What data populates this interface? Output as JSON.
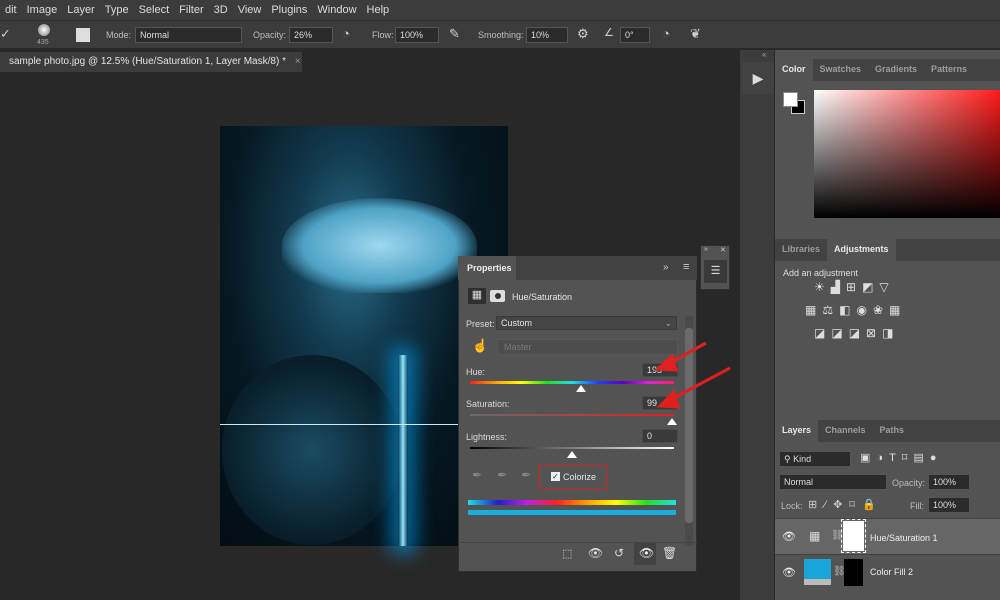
{
  "menu": [
    "dit",
    "Image",
    "Layer",
    "Type",
    "Select",
    "Filter",
    "3D",
    "View",
    "Plugins",
    "Window",
    "Help"
  ],
  "options": {
    "brush_size": "435",
    "mode_label": "Mode:",
    "mode_value": "Normal",
    "opacity_label": "Opacity:",
    "opacity_value": "26%",
    "flow_label": "Flow:",
    "flow_value": "100%",
    "smoothing_label": "Smoothing:",
    "smoothing_value": "10%",
    "angle_value": "0°"
  },
  "document_tab": {
    "title": "sample photo.jpg @ 12.5% (Hue/Saturation 1, Layer Mask/8) *",
    "close": "×"
  },
  "color_panel": {
    "tabs": [
      "Color",
      "Swatches",
      "Gradients",
      "Patterns"
    ],
    "active": "Color",
    "foreground": "#ffffff",
    "background": "#000000",
    "hue_color": "#ff1a1a"
  },
  "adjustments_panel": {
    "tabs": [
      "Libraries",
      "Adjustments"
    ],
    "active": "Adjustments",
    "hint": "Add an adjustment"
  },
  "properties": {
    "title": "Properties",
    "type": "Hue/Saturation",
    "preset_label": "Preset:",
    "preset_value": "Custom",
    "channel_value": "Master",
    "hue_label": "Hue:",
    "hue_value": "195",
    "saturation_label": "Saturation:",
    "saturation_value": "99",
    "lightness_label": "Lightness:",
    "lightness_value": "0",
    "colorize_label": "Colorize",
    "colorize_checked": true,
    "hue": 195,
    "saturation": 99,
    "lightness": 0,
    "colorize_color": "#1aaee0",
    "annotation_color": "#e02020"
  },
  "layers_panel": {
    "tabs": [
      "Layers",
      "Channels",
      "Paths"
    ],
    "active": "Layers",
    "filter_kind": "Kind",
    "blend_mode": "Normal",
    "opacity_label": "Opacity:",
    "opacity_value": "100%",
    "lock_label": "Lock:",
    "fill_label": "Fill:",
    "fill_value": "100%",
    "layers": [
      {
        "name": "Hue/Saturation 1",
        "visible": true,
        "selected": true
      },
      {
        "name": "Color Fill 2",
        "visible": true,
        "selected": false,
        "fill_color": "#1aa6d8"
      }
    ]
  }
}
